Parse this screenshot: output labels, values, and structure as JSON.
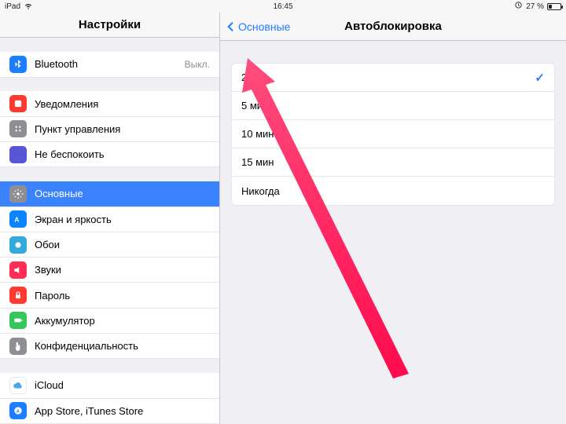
{
  "status": {
    "device": "iPad",
    "wifi_icon": "wifi",
    "time": "16:45",
    "rotation_lock_icon": "rotation-lock",
    "battery_percent": "27 %"
  },
  "sidebar": {
    "title": "Настройки",
    "bluetooth": {
      "label": "Bluetooth",
      "value": "Выкл."
    },
    "notifications": {
      "label": "Уведомления"
    },
    "control_center": {
      "label": "Пункт управления"
    },
    "dnd": {
      "label": "Не беспокоить"
    },
    "general": {
      "label": "Основные"
    },
    "display": {
      "label": "Экран и яркость"
    },
    "wallpaper": {
      "label": "Обои"
    },
    "sounds": {
      "label": "Звуки"
    },
    "passcode": {
      "label": "Пароль"
    },
    "battery": {
      "label": "Аккумулятор"
    },
    "privacy": {
      "label": "Конфиденциальность"
    },
    "icloud": {
      "label": "iCloud",
      "sub": " "
    },
    "store": {
      "label": "App Store, iTunes Store"
    }
  },
  "detail": {
    "back_label": "Основные",
    "title": "Автоблокировка",
    "options": [
      {
        "label": "2 мин",
        "selected": true
      },
      {
        "label": "5 мин",
        "selected": false
      },
      {
        "label": "10 мин",
        "selected": false
      },
      {
        "label": "15 мин",
        "selected": false
      },
      {
        "label": "Никогда",
        "selected": false
      }
    ]
  },
  "colors": {
    "accent": "#1d7eff",
    "arrow": "#ff0a4d"
  }
}
